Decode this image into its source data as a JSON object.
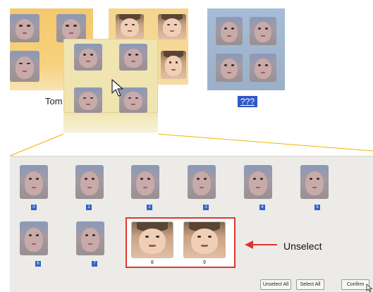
{
  "clusters": [
    {
      "id": "tom",
      "label": "Tom"
    },
    {
      "id": "other",
      "label": ""
    },
    {
      "id": "unknown",
      "label": "???"
    }
  ],
  "gallery": {
    "row1_indices": [
      "0",
      "1",
      "2",
      "3",
      "4",
      "5"
    ],
    "row2_indices": [
      "6",
      "7"
    ],
    "selected_indices": [
      "8",
      "9"
    ]
  },
  "annotation": {
    "label": "Unselect",
    "arrow_color": "#e0352f",
    "highlight_color": "#e0352f"
  },
  "toolbar": {
    "unselect_all_label": "Unselect All",
    "select_all_label": "Select All",
    "confirm_label": "Confirm"
  },
  "colors": {
    "tom_card": "#f3c86d",
    "unknown_card": "#a7bcd6",
    "index_badge": "#2f63c9",
    "unknown_badge": "#2f58c8",
    "panel_bg": "#ecebe7"
  }
}
